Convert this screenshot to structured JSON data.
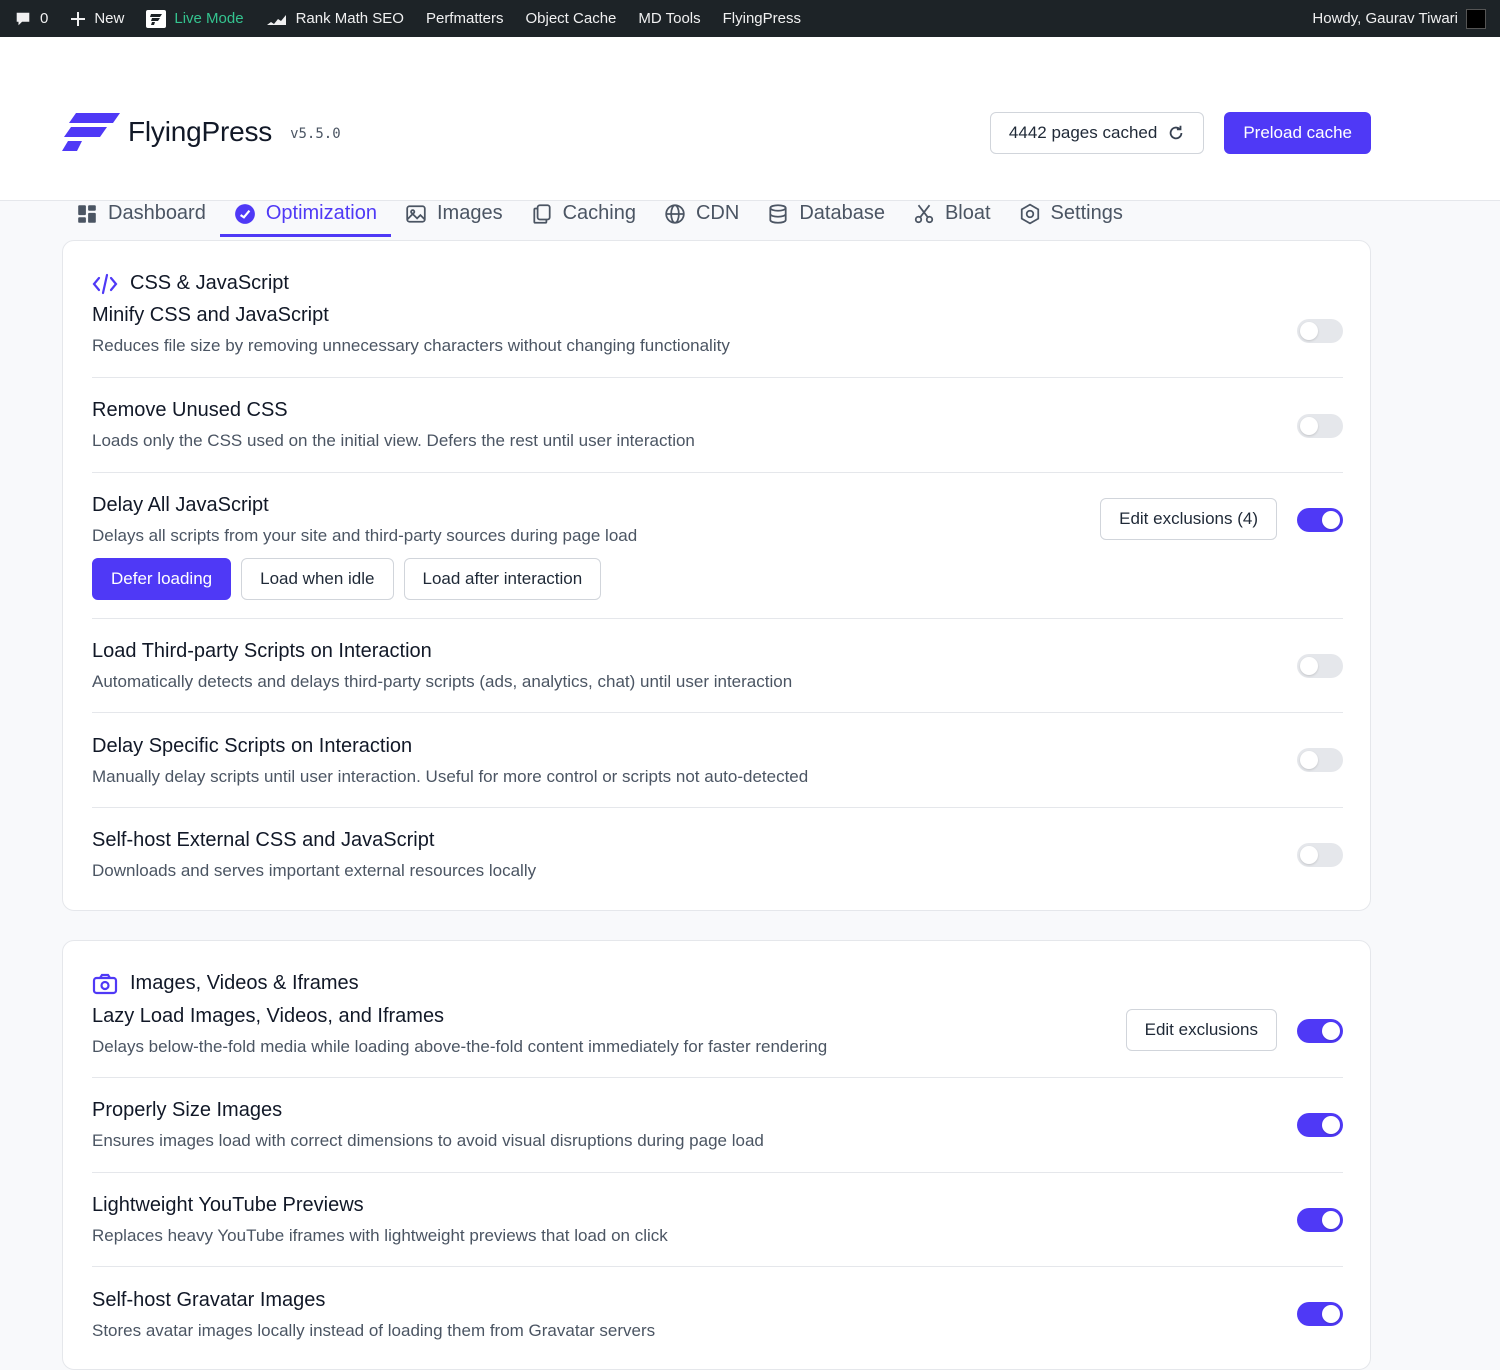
{
  "adminbar": {
    "comments_count": "0",
    "new_label": "New",
    "live_mode": "Live Mode",
    "items": [
      "Rank Math SEO",
      "Perfmatters",
      "Object Cache",
      "MD Tools",
      "FlyingPress"
    ],
    "howdy": "Howdy, Gaurav Tiwari"
  },
  "header": {
    "brand": "FlyingPress",
    "version": "v5.5.0",
    "pages_cached": "4442 pages cached",
    "preload_label": "Preload cache"
  },
  "tabs": [
    {
      "label": "Dashboard",
      "icon": "grid-icon"
    },
    {
      "label": "Optimization",
      "icon": "gauge-icon",
      "active": true
    },
    {
      "label": "Images",
      "icon": "image-icon"
    },
    {
      "label": "Caching",
      "icon": "copy-icon"
    },
    {
      "label": "CDN",
      "icon": "globe-icon"
    },
    {
      "label": "Database",
      "icon": "database-icon"
    },
    {
      "label": "Bloat",
      "icon": "scissors-icon"
    },
    {
      "label": "Settings",
      "icon": "gear-icon"
    }
  ],
  "sections": [
    {
      "title": "CSS & JavaScript",
      "icon": "code-icon",
      "rows": [
        {
          "title": "Minify CSS and JavaScript",
          "desc": "Reduces file size by removing unnecessary characters without changing functionality",
          "enabled": false
        },
        {
          "title": "Remove Unused CSS",
          "desc": "Loads only the CSS used on the initial view. Defers the rest until user interaction",
          "enabled": false
        },
        {
          "title": "Delay All JavaScript",
          "desc": "Delays all scripts from your site and third-party sources during page load",
          "enabled": true,
          "edit_label": "Edit exclusions (4)",
          "modes": [
            "Defer loading",
            "Load when idle",
            "Load after interaction"
          ],
          "selected_mode": "Defer loading"
        },
        {
          "title": "Load Third-party Scripts on Interaction",
          "desc": "Automatically detects and delays third-party scripts (ads, analytics, chat) until user interaction",
          "enabled": false
        },
        {
          "title": "Delay Specific Scripts on Interaction",
          "desc": "Manually delay scripts until user interaction. Useful for more control or scripts not auto-detected",
          "enabled": false
        },
        {
          "title": "Self-host External CSS and JavaScript",
          "desc": "Downloads and serves important external resources locally",
          "enabled": false
        }
      ]
    },
    {
      "title": "Images, Videos & Iframes",
      "icon": "camera-icon",
      "rows": [
        {
          "title": "Lazy Load Images, Videos, and Iframes",
          "desc": "Delays below-the-fold media while loading above-the-fold content immediately for faster rendering",
          "enabled": true,
          "edit_label": "Edit exclusions"
        },
        {
          "title": "Properly Size Images",
          "desc": "Ensures images load with correct dimensions to avoid visual disruptions during page load",
          "enabled": true
        },
        {
          "title": "Lightweight YouTube Previews",
          "desc": "Replaces heavy YouTube iframes with lightweight previews that load on click",
          "enabled": true
        },
        {
          "title": "Self-host Gravatar Images",
          "desc": "Stores avatar images locally instead of loading them from Gravatar servers",
          "enabled": true
        }
      ]
    }
  ],
  "colors": {
    "accent": "#4f39f6",
    "live": "#34c38f"
  }
}
